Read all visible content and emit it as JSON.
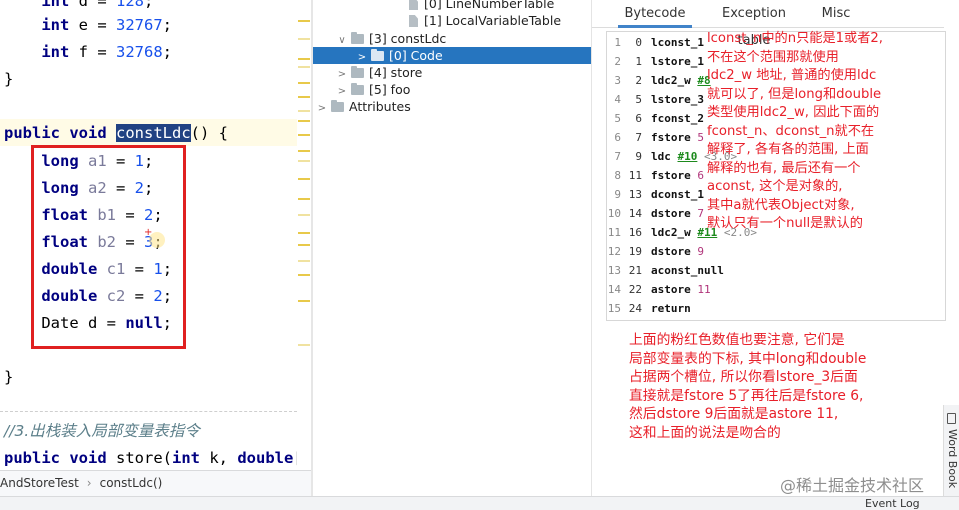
{
  "editor": {
    "lines": [
      {
        "tokens": [
          {
            "t": "    ",
            "c": ""
          },
          {
            "t": "int",
            "c": "kw"
          },
          {
            "t": " d = ",
            "c": ""
          },
          {
            "t": "128",
            "c": "num"
          },
          {
            "t": ";",
            "c": ""
          }
        ]
      },
      {
        "tokens": [
          {
            "t": "    ",
            "c": ""
          },
          {
            "t": "int",
            "c": "kw"
          },
          {
            "t": " e = ",
            "c": ""
          },
          {
            "t": "32767",
            "c": "num"
          },
          {
            "t": ";",
            "c": ""
          }
        ]
      },
      {
        "tokens": [
          {
            "t": "    ",
            "c": ""
          },
          {
            "t": "int",
            "c": "kw"
          },
          {
            "t": " f = ",
            "c": ""
          },
          {
            "t": "32768",
            "c": "num"
          },
          {
            "t": ";",
            "c": ""
          }
        ]
      },
      {
        "tokens": [
          {
            "t": "}",
            "c": ""
          }
        ]
      },
      {
        "tokens": [
          {
            "t": "",
            "c": ""
          }
        ]
      },
      {
        "tokens": [
          {
            "t": "public",
            "c": "kw"
          },
          {
            "t": " ",
            "c": ""
          },
          {
            "t": "void",
            "c": "kw"
          },
          {
            "t": " ",
            "c": ""
          },
          {
            "t": "constLdc",
            "c": "sel"
          },
          {
            "t": "() {",
            "c": ""
          }
        ]
      },
      {
        "tokens": [
          {
            "t": "    ",
            "c": ""
          },
          {
            "t": "long",
            "c": "kw"
          },
          {
            "t": " ",
            "c": ""
          },
          {
            "t": "a1",
            "c": "var"
          },
          {
            "t": " = ",
            "c": ""
          },
          {
            "t": "1",
            "c": "num"
          },
          {
            "t": ";",
            "c": ""
          }
        ]
      },
      {
        "tokens": [
          {
            "t": "    ",
            "c": ""
          },
          {
            "t": "long",
            "c": "kw"
          },
          {
            "t": " ",
            "c": ""
          },
          {
            "t": "a2",
            "c": "var"
          },
          {
            "t": " = ",
            "c": ""
          },
          {
            "t": "2",
            "c": "num"
          },
          {
            "t": ";",
            "c": ""
          }
        ]
      },
      {
        "tokens": [
          {
            "t": "    ",
            "c": ""
          },
          {
            "t": "float",
            "c": "kw"
          },
          {
            "t": " ",
            "c": ""
          },
          {
            "t": "b1",
            "c": "var"
          },
          {
            "t": " = ",
            "c": ""
          },
          {
            "t": "2",
            "c": "num"
          },
          {
            "t": ";",
            "c": ""
          }
        ]
      },
      {
        "tokens": [
          {
            "t": "    ",
            "c": ""
          },
          {
            "t": "float",
            "c": "kw"
          },
          {
            "t": " ",
            "c": ""
          },
          {
            "t": "b2",
            "c": "var"
          },
          {
            "t": " = ",
            "c": ""
          },
          {
            "t": "3",
            "c": "num"
          },
          {
            "t": ";",
            "c": ""
          }
        ]
      },
      {
        "tokens": [
          {
            "t": "    ",
            "c": ""
          },
          {
            "t": "double",
            "c": "kw"
          },
          {
            "t": " ",
            "c": ""
          },
          {
            "t": "c1",
            "c": "var"
          },
          {
            "t": " = ",
            "c": ""
          },
          {
            "t": "1",
            "c": "num"
          },
          {
            "t": ";",
            "c": ""
          }
        ]
      },
      {
        "tokens": [
          {
            "t": "    ",
            "c": ""
          },
          {
            "t": "double",
            "c": "kw"
          },
          {
            "t": " ",
            "c": ""
          },
          {
            "t": "c2",
            "c": "var"
          },
          {
            "t": " = ",
            "c": ""
          },
          {
            "t": "2",
            "c": "num"
          },
          {
            "t": ";",
            "c": ""
          }
        ]
      },
      {
        "tokens": [
          {
            "t": "    ",
            "c": ""
          },
          {
            "t": "Date d = ",
            "c": ""
          },
          {
            "t": "null",
            "c": "lit"
          },
          {
            "t": ";",
            "c": ""
          }
        ]
      },
      {
        "tokens": [
          {
            "t": "",
            "c": ""
          }
        ]
      },
      {
        "tokens": [
          {
            "t": "}",
            "c": ""
          }
        ]
      },
      {
        "tokens": [
          {
            "t": "",
            "c": ""
          }
        ]
      },
      {
        "tokens": [
          {
            "t": "//3.出栈装入局部变量表指令",
            "c": "cmt"
          }
        ]
      },
      {
        "tokens": [
          {
            "t": "public",
            "c": "kw"
          },
          {
            "t": " ",
            "c": ""
          },
          {
            "t": "void",
            "c": "kw"
          },
          {
            "t": " store(",
            "c": ""
          },
          {
            "t": "int",
            "c": "kw"
          },
          {
            "t": " k, ",
            "c": ""
          },
          {
            "t": "double",
            "c": "kw"
          },
          {
            "t": "[",
            "c": ""
          }
        ]
      }
    ]
  },
  "breadcrumb": {
    "file": "AndStoreTest",
    "method": "constLdc()"
  },
  "tree": {
    "nodes": [
      {
        "label": "[0] LineNumberTable",
        "icon": "file-icon",
        "chevron": "",
        "selected": false
      },
      {
        "label": "[1] LocalVariableTable",
        "icon": "file-icon",
        "chevron": "",
        "selected": false
      },
      {
        "label": "[3] constLdc",
        "icon": "folder-icon",
        "chevron": "∨",
        "selected": false
      },
      {
        "label": "[0] Code",
        "icon": "folder-icon",
        "chevron": ">",
        "selected": true
      },
      {
        "label": "[4] store",
        "icon": "folder-icon",
        "chevron": ">",
        "selected": false
      },
      {
        "label": "[5] foo",
        "icon": "folder-icon",
        "chevron": ">",
        "selected": false
      },
      {
        "label": "Attributes",
        "icon": "folder-icon",
        "chevron": ">",
        "selected": false
      }
    ]
  },
  "tabs": [
    {
      "label": "Bytecode",
      "active": true
    },
    {
      "label": "Exception table",
      "active": false
    },
    {
      "label": "Misc",
      "active": false
    }
  ],
  "bytecode": [
    {
      "line": "1",
      "offset": "0",
      "op": "lconst_1",
      "arg": "",
      "link": "",
      "comment": ""
    },
    {
      "line": "2",
      "offset": "1",
      "op": "lstore_1",
      "arg": "",
      "link": "",
      "comment": ""
    },
    {
      "line": "3",
      "offset": "2",
      "op": "ldc2_w",
      "arg": "",
      "link": "#8",
      "comment": ""
    },
    {
      "line": "4",
      "offset": "5",
      "op": "lstore_3",
      "arg": "",
      "link": "",
      "comment": ""
    },
    {
      "line": "5",
      "offset": "6",
      "op": "fconst_2",
      "arg": "",
      "link": "",
      "comment": ""
    },
    {
      "line": "6",
      "offset": "7",
      "op": "fstore",
      "arg": "5",
      "link": "",
      "comment": ""
    },
    {
      "line": "7",
      "offset": "9",
      "op": "ldc",
      "arg": "",
      "link": "#10",
      "comment": "<3.0>"
    },
    {
      "line": "8",
      "offset": "11",
      "op": "fstore",
      "arg": "6",
      "link": "",
      "comment": ""
    },
    {
      "line": "9",
      "offset": "13",
      "op": "dconst_1",
      "arg": "",
      "link": "",
      "comment": ""
    },
    {
      "line": "10",
      "offset": "14",
      "op": "dstore",
      "arg": "7",
      "link": "",
      "comment": ""
    },
    {
      "line": "11",
      "offset": "16",
      "op": "ldc2_w",
      "arg": "",
      "link": "#11",
      "comment": "<2.0>"
    },
    {
      "line": "12",
      "offset": "19",
      "op": "dstore",
      "arg": "9",
      "link": "",
      "comment": ""
    },
    {
      "line": "13",
      "offset": "21",
      "op": "aconst_null",
      "arg": "",
      "link": "",
      "comment": ""
    },
    {
      "line": "14",
      "offset": "22",
      "op": "astore",
      "arg": "11",
      "link": "",
      "comment": ""
    },
    {
      "line": "15",
      "offset": "24",
      "op": "return",
      "arg": "",
      "link": "",
      "comment": ""
    }
  ],
  "annotations": {
    "top": "lconst_n中的n只能是1或者2,\n不在这个范围那就使用\nldc2_w 地址, 普通的使用ldc\n就可以了, 但是long和double\n类型使用ldc2_w, 因此下面的\nfconst_n、dconst_n就不在\n解释了, 各有各的范围, 上面\n解释的也有, 最后还有一个\naconst, 这个是对象的,\n其中a就代表Object对象,\n默认只有一个null是默认的",
    "bottom": "上面的粉红色数值也要注意, 它们是\n局部变量表的下标, 其中long和double\n占据两个槽位, 所以你看lstore_3后面\n直接就是fstore 5了再往后是fstore 6,\n然后dstore 9后面就是astore 11,\n这和上面的说法是吻合的"
  },
  "sidebar": {
    "word_book": "Word Book"
  },
  "watermark": "@稀土掘金技术社区",
  "event_log": "Event Log",
  "colors": {
    "selection": "#2675bf",
    "annotation": "#e8202a",
    "redbox": "#e02020"
  }
}
